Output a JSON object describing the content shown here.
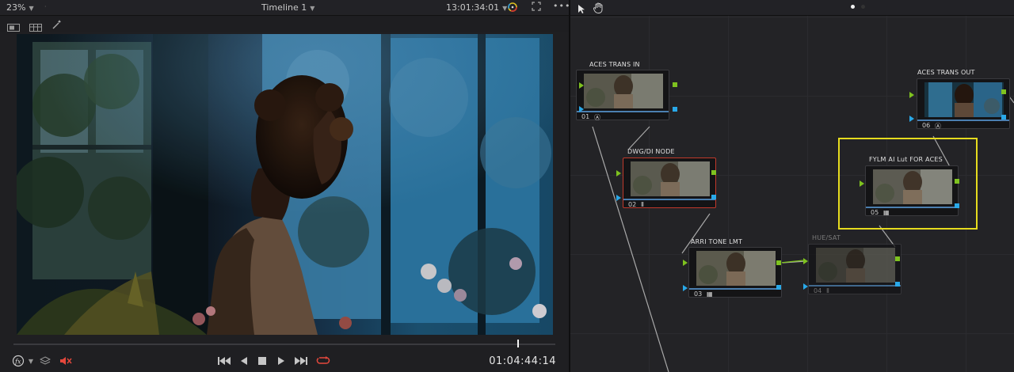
{
  "viewer": {
    "zoom": "23%",
    "timeline_title": "Timeline 1",
    "source_timecode": "13:01:34:01",
    "playhead_timecode": "01:04:44:14",
    "playhead_position_fraction": 0.93
  },
  "icons": {
    "zoom_caret": "chevron-down-icon",
    "color_picker": "color-wheel-icon",
    "expand": "expand-icon",
    "more": "more-icon",
    "pointer": "pointer-icon",
    "hand": "hand-icon",
    "single_view": "single-viewer-icon",
    "cinema_view": "cinema-viewer-icon",
    "magic": "magic-wand-icon",
    "fx": "fx-icon",
    "layers": "layers-icon",
    "mute": "speaker-muted-icon",
    "first": "skip-first-icon",
    "reverse": "play-reverse-icon",
    "stop": "stop-icon",
    "play": "play-icon",
    "last": "skip-last-icon",
    "loop": "loop-icon"
  },
  "colors": {
    "loop_active": "#e5483c",
    "selection_yellow": "#e6dc1e",
    "selected_node_red": "#c0392b",
    "port_green": "#7ec21f",
    "port_blue": "#29a8e8"
  },
  "nodes": [
    {
      "label": "ACES TRANS IN",
      "number": "01",
      "tool_icon": "aces-icon",
      "tool_glyph": "Ⓐ"
    },
    {
      "label": "DWG/DI NODE",
      "number": "02",
      "tool_icon": "levels-icon",
      "tool_glyph": "Ⅱ"
    },
    {
      "label": "ARRI TONE LMT",
      "number": "03",
      "tool_icon": "grid-lut-icon",
      "tool_glyph": "▦"
    },
    {
      "label": "HUE/SAT",
      "number": "04",
      "tool_icon": "levels-icon",
      "tool_glyph": "Ⅱ",
      "disabled": true
    },
    {
      "label": "FYLM AI Lut FOR ACES",
      "number": "05",
      "tool_icon": "grid-lut-icon",
      "tool_glyph": "▦"
    },
    {
      "label": "ACES TRANS OUT",
      "number": "06",
      "tool_icon": "aces-icon",
      "tool_glyph": "Ⓐ"
    }
  ]
}
